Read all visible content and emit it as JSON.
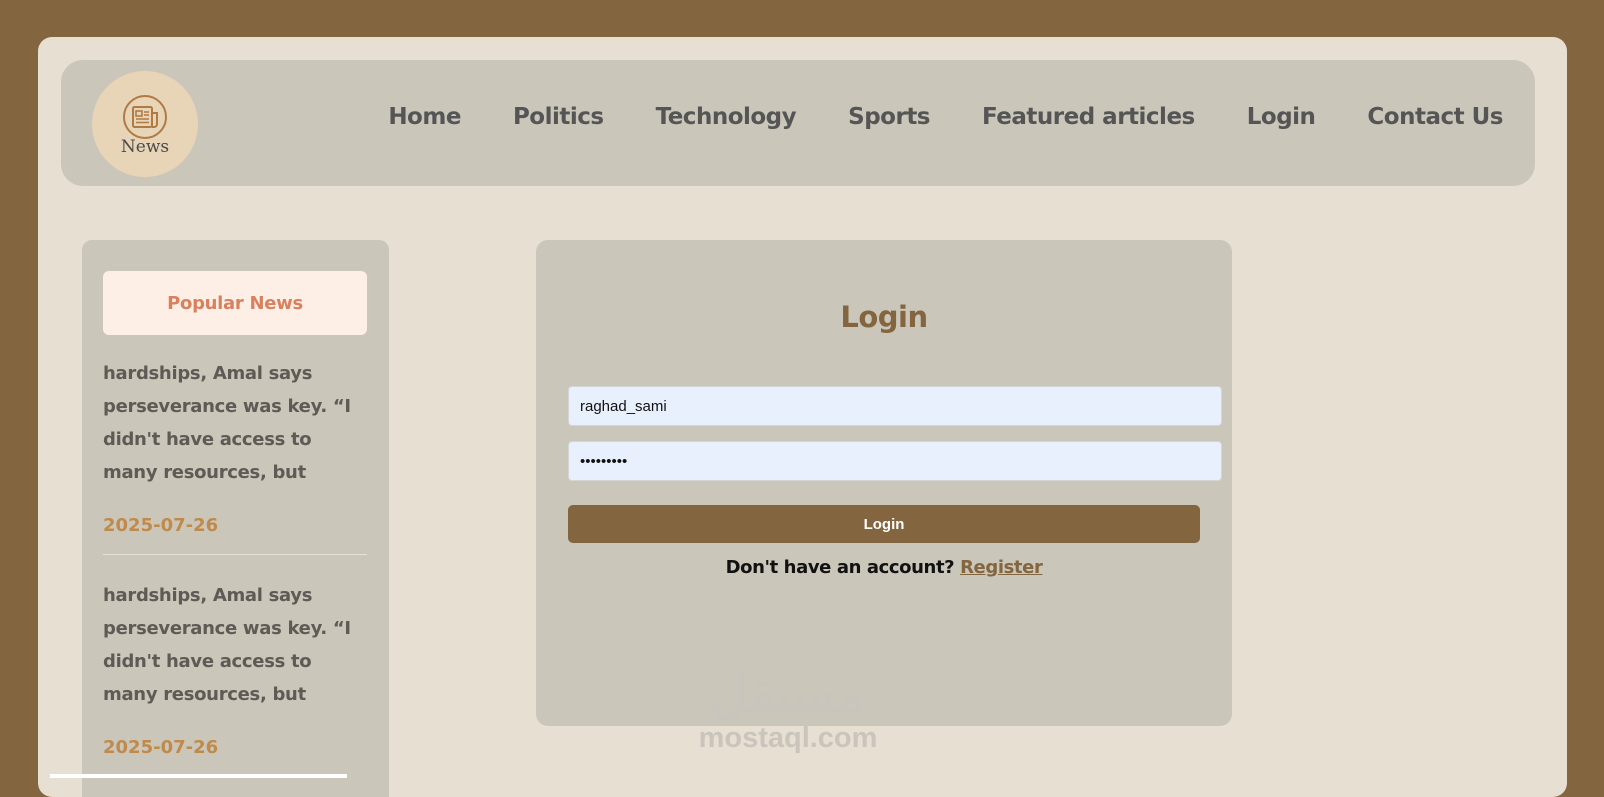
{
  "logo": {
    "text": "News",
    "icon": "newspaper-icon"
  },
  "nav": [
    {
      "label": "Home"
    },
    {
      "label": "Politics"
    },
    {
      "label": "Technology"
    },
    {
      "label": "Sports"
    },
    {
      "label": "Featured articles"
    },
    {
      "label": "Login"
    },
    {
      "label": "Contact Us"
    }
  ],
  "sidebar": {
    "title": "Popular News",
    "items": [
      {
        "text": "hardships, Amal says perseverance was key. “I didn't have access to many resources, but",
        "date": "2025-07-26"
      },
      {
        "text": "hardships, Amal says perseverance was key. “I didn't have access to many resources, but",
        "date": "2025-07-26"
      }
    ]
  },
  "login": {
    "title": "Login",
    "username_value": "raghad_sami",
    "password_value": "•••••••••",
    "button_label": "Login",
    "register_prompt": "Don't have an account?",
    "register_link": "Register"
  },
  "watermark": {
    "arabic": "مستقل",
    "latin": "mostaql.com"
  },
  "colors": {
    "outer_background": "#83653f",
    "page_background": "#e7dfd1",
    "panel": "#cbc6ba",
    "accent": "#83653f",
    "popular_title": "#d9805f",
    "date": "#c08a4a",
    "input_background": "#e8f0fe"
  }
}
